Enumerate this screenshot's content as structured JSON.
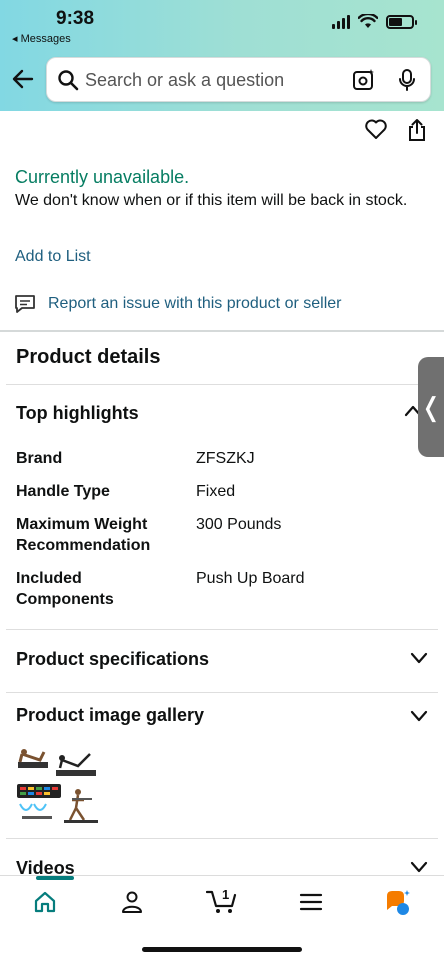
{
  "status_bar": {
    "time": "9:38",
    "back_app": "◂ Messages"
  },
  "search": {
    "placeholder": "Search or ask a question"
  },
  "availability": {
    "status": "Currently unavailable.",
    "note": "We don't know when or if this item will be back in stock."
  },
  "actions": {
    "add_to_list": "Add to List",
    "report": "Report an issue with this product or seller"
  },
  "product_details": {
    "title": "Product details",
    "highlights_title": "Top highlights",
    "specs": [
      {
        "label": "Brand",
        "value": "ZFSZKJ"
      },
      {
        "label": "Handle Type",
        "value": "Fixed"
      },
      {
        "label": "Maximum Weight Recommendation",
        "value": "300 Pounds"
      },
      {
        "label": "Included Components",
        "value": "Push Up Board"
      }
    ]
  },
  "sections": {
    "specifications": "Product specifications",
    "gallery": "Product image gallery",
    "videos": "Videos"
  },
  "side_tab": {
    "glyph": "❬"
  },
  "cart": {
    "count": "1"
  },
  "colors": {
    "accent_green": "#067d62",
    "link_blue": "#1f5f7f",
    "header_start": "#82d8e3",
    "header_end": "#a7e4cf"
  }
}
